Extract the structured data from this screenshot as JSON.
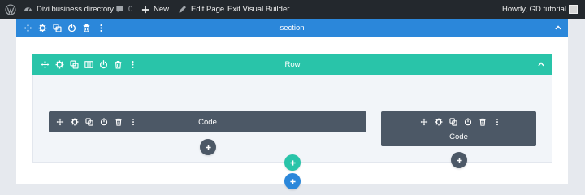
{
  "admin_bar": {
    "site_name": "Divi business directory",
    "comments_count": "0",
    "new_label": "New",
    "edit_page_label": "Edit Page",
    "exit_builder_label": "Exit Visual Builder",
    "greeting": "Howdy, GD tutorial"
  },
  "section": {
    "label": "section",
    "color": "#2b87da"
  },
  "row": {
    "label": "Row",
    "color": "#29c4a9"
  },
  "modules": [
    {
      "label": "Code"
    },
    {
      "label": "Code"
    }
  ],
  "colors": {
    "admin_bar": "#23282d",
    "module": "#4c5866",
    "add_module": "#4c5866",
    "add_row": "#29c4a9",
    "add_section": "#2b87da"
  }
}
